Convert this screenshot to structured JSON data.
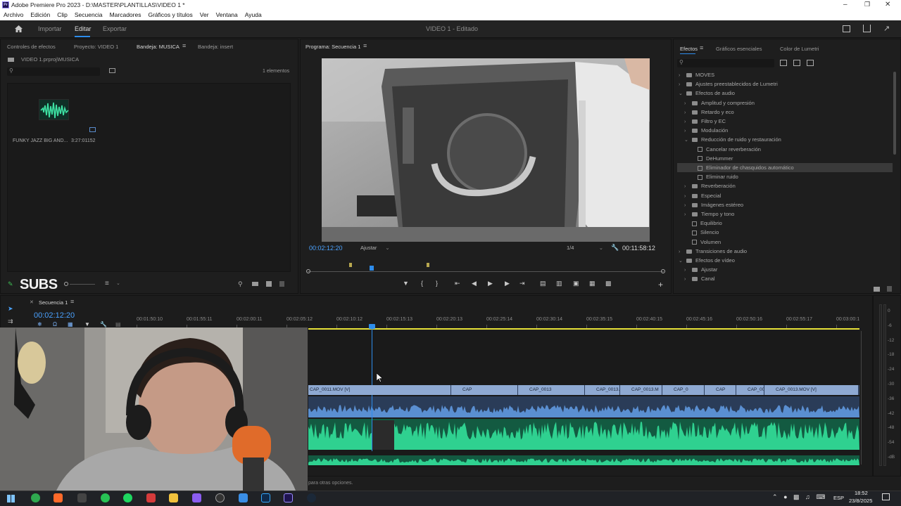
{
  "app": {
    "title": "Adobe Premiere Pro 2023 - D:\\MASTER\\PLANTILLAS\\VIDEO 1 *",
    "project_name": "VIDEO 1",
    "status": "Editado",
    "logo": "Pr"
  },
  "menu": [
    "Archivo",
    "Edición",
    "Clip",
    "Secuencia",
    "Marcadores",
    "Gráficos y títulos",
    "Ver",
    "Ventana",
    "Ayuda"
  ],
  "workspace": {
    "import": "Importar",
    "edit": "Editar",
    "export": "Exportar"
  },
  "project_panel": {
    "tabs": [
      "Controles de efectos",
      "Proyecto: VIDEO 1",
      "Bandeja: MUSICA",
      "Bandeja: insert"
    ],
    "path": "VIDEO 1.prproj\\MUSICA",
    "count": "1 elementos",
    "item": {
      "name": "FUNKY JAZZ BIG AND...",
      "duration": "3:27:01152"
    }
  },
  "program_monitor": {
    "title": "Programa: Secuencia 1",
    "timecode": "00:02:12:20",
    "fit": "Ajustar",
    "resolution": "1/4",
    "duration": "00:11:58:12"
  },
  "effects_panel": {
    "tabs": [
      "Efectos",
      "Gráficos esenciales",
      "Color de Lumetri"
    ],
    "items": [
      {
        "label": "MOVES",
        "level": 0,
        "kind": "folder",
        "open": false
      },
      {
        "label": "Ajustes preestablecidos de Lumetri",
        "level": 0,
        "kind": "folder",
        "open": false
      },
      {
        "label": "Efectos de audio",
        "level": 0,
        "kind": "folder",
        "open": true
      },
      {
        "label": "Amplitud y compresión",
        "level": 1,
        "kind": "folder",
        "open": false
      },
      {
        "label": "Retardo y eco",
        "level": 1,
        "kind": "folder",
        "open": false
      },
      {
        "label": "Filtro y EC",
        "level": 1,
        "kind": "folder",
        "open": false
      },
      {
        "label": "Modulación",
        "level": 1,
        "kind": "folder",
        "open": false
      },
      {
        "label": "Reducción de ruido y restauración",
        "level": 1,
        "kind": "folder",
        "open": true
      },
      {
        "label": "Cancelar reverberación",
        "level": 2,
        "kind": "fx"
      },
      {
        "label": "DeHummer",
        "level": 2,
        "kind": "fx"
      },
      {
        "label": "Eliminador de chasquidos automático",
        "level": 2,
        "kind": "fx",
        "selected": true
      },
      {
        "label": "Eliminar ruido",
        "level": 2,
        "kind": "fx"
      },
      {
        "label": "Reverberación",
        "level": 1,
        "kind": "folder",
        "open": false
      },
      {
        "label": "Especial",
        "level": 1,
        "kind": "folder",
        "open": false
      },
      {
        "label": "Imágenes estéreo",
        "level": 1,
        "kind": "folder",
        "open": false
      },
      {
        "label": "Tiempo y tono",
        "level": 1,
        "kind": "folder",
        "open": false
      },
      {
        "label": "Equilibrio",
        "level": 1,
        "kind": "fx"
      },
      {
        "label": "Silencio",
        "level": 1,
        "kind": "fx"
      },
      {
        "label": "Volumen",
        "level": 1,
        "kind": "fx"
      },
      {
        "label": "Transiciones de audio",
        "level": 0,
        "kind": "folder",
        "open": false
      },
      {
        "label": "Efectos de vídeo",
        "level": 0,
        "kind": "folder",
        "open": true
      },
      {
        "label": "Ajustar",
        "level": 1,
        "kind": "folder",
        "open": false
      },
      {
        "label": "Canal",
        "level": 1,
        "kind": "folder",
        "open": false
      }
    ]
  },
  "subs_label": "SUBS",
  "timeline": {
    "tab": "Secuencia 1",
    "timecode": "00:02:12:20",
    "ruler": [
      "00:01:50:10",
      "00:01:55:11",
      "00:02:00:11",
      "00:02:05:12",
      "00:02:10:12",
      "00:02:15:13",
      "00:02:20:13",
      "00:02:25:14",
      "00:02:30:14",
      "00:02:35:15",
      "00:02:40:15",
      "00:02:45:16",
      "00:02:50:16",
      "00:02:55:17",
      "00:03:00:1"
    ],
    "clips": [
      "CAP_0011.MOV [V]",
      "CAP",
      "CAP_0013",
      "CAP_0013.",
      "CAP_0013.M",
      "CAP_0",
      "CAP",
      "CAP_0013",
      "CAP_0013.MOV [V]"
    ],
    "meter_scale": [
      "0",
      "-6",
      "-12",
      "-18",
      "-24",
      "-30",
      "-36",
      "-42",
      "-48",
      "-54",
      "-dB"
    ],
    "status": "para otras opciones."
  },
  "taskbar": {
    "lang": "ESP",
    "time": "18:52",
    "date": "23/8/2025"
  },
  "colors": {
    "accent": "#2d8ceb",
    "video_clip": "#8ea9d2",
    "audio_wave": "#2fbf86",
    "audio_wave2": "#4a76b0",
    "in_out": "#e7e138"
  }
}
